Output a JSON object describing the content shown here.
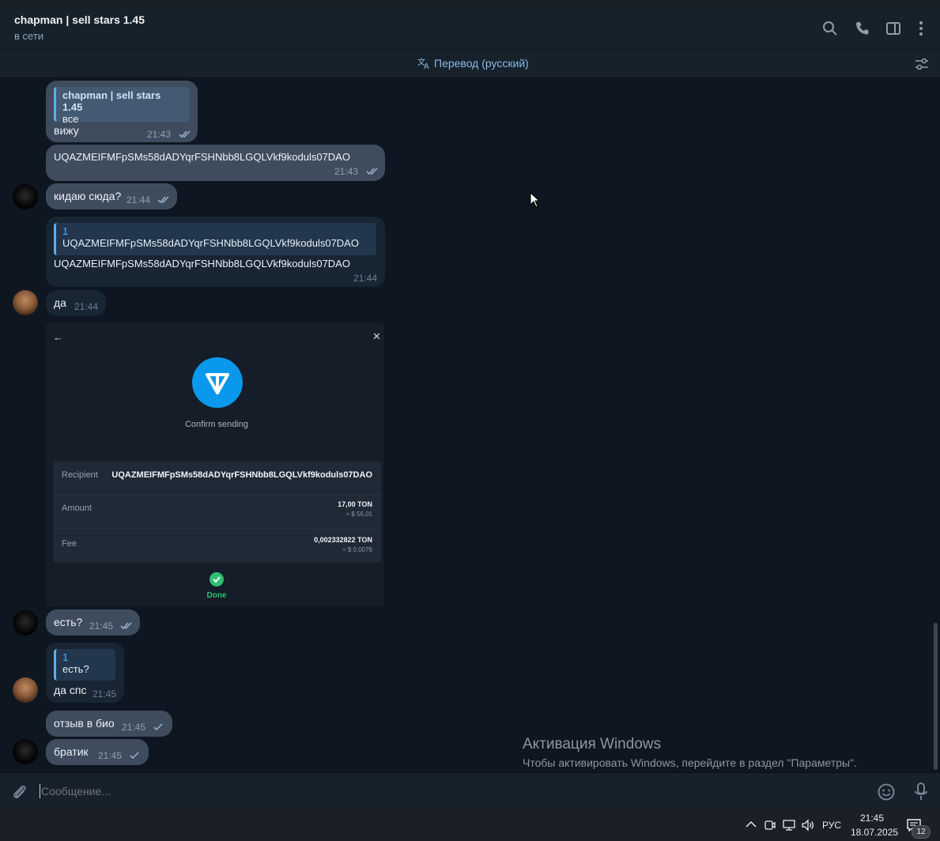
{
  "header": {
    "title": "chapman | sell stars 1.45",
    "status": "в сети"
  },
  "translation": {
    "label": "Перевод (русский)"
  },
  "messages": {
    "m1": {
      "reply_name": "chapman | sell stars 1.45",
      "reply_text": "все",
      "text": "вижу",
      "time": "21:43"
    },
    "m2": {
      "text": "UQAZMEIFMFpSMs58dADYqrFSHNbb8LGQLVkf9koduls07DAO",
      "time": "21:43"
    },
    "m3": {
      "text": "кидаю сюда?",
      "time": "21:44"
    },
    "m4": {
      "reply_name": "1",
      "reply_text": "UQAZMEIFMFpSMs58dADYqrFSHNbb8LGQLVkf9koduls07DAO",
      "text": "UQAZMEIFMFpSMs58dADYqrFSHNbb8LGQLVkf9koduls07DAO",
      "time": "21:44"
    },
    "m5": {
      "text": "да",
      "time": "21:44"
    },
    "m6": {
      "text": "есть?",
      "time": "21:45"
    },
    "m7": {
      "reply_name": "1",
      "reply_text": "есть?",
      "text": "да спс",
      "time": "21:45"
    },
    "m8": {
      "text": "отзыв в био",
      "time": "21:45"
    },
    "m9": {
      "text": "братик",
      "time": "21:45"
    }
  },
  "screenshot": {
    "confirm_label": "Confirm sending",
    "recipient_label": "Recipient",
    "recipient_value": "UQAZMEIFMFpSMs58dADYqrFSHNbb8LGQLVkf9koduls07DAO",
    "amount_label": "Amount",
    "amount_value": "17,00 TON",
    "amount_usd": "≈ $ 56,01",
    "fee_label": "Fee",
    "fee_value": "0,002332822 TON",
    "fee_usd": "≈ $ 0,0076",
    "done_label": "Done"
  },
  "watermark": {
    "title": "Активация Windows",
    "subtitle": "Чтобы активировать Windows, перейдите в раздел \"Параметры\"."
  },
  "composer": {
    "placeholder": "Сообщение..."
  },
  "taskbar": {
    "lang": "РУС",
    "time": "21:45",
    "date": "18.07.2025",
    "notifications": "12"
  },
  "colors": {
    "chat_bg": "#0e1621",
    "outgoing_bubble": "#3e4c5e",
    "incoming_bubble": "#182533",
    "accent": "#5ab0f0",
    "ton_blue": "#0a98ec",
    "done_green": "#2fbf71"
  }
}
